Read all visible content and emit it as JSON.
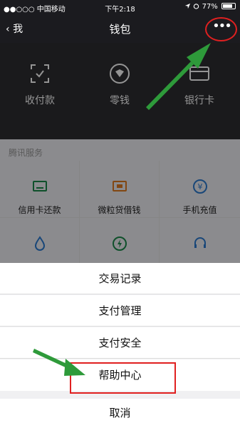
{
  "status_bar": {
    "carrier": "●●○○○ 中国移动",
    "time": "下午2:18",
    "battery": "77%"
  },
  "nav": {
    "back_label": "我",
    "title": "钱包",
    "more_glyph": "•••"
  },
  "wallet_top": [
    {
      "label": "收付款",
      "icon": "scan-pay-icon"
    },
    {
      "label": "零钱",
      "icon": "coin-icon"
    },
    {
      "label": "银行卡",
      "icon": "bank-card-icon"
    }
  ],
  "services": {
    "section_title": "腾讯服务",
    "items": [
      {
        "label": "信用卡还款",
        "icon": "credit-card-icon",
        "color": "#1a8a4a"
      },
      {
        "label": "微粒贷借钱",
        "icon": "loan-icon",
        "color": "#e07a1f"
      },
      {
        "label": "手机充值",
        "icon": "phone-topup-icon",
        "color": "#2b7bd0"
      },
      {
        "label": "",
        "icon": "water-drop-icon",
        "color": "#2b7bd0"
      },
      {
        "label": "",
        "icon": "charge-icon",
        "color": "#1a8a4a"
      },
      {
        "label": "",
        "icon": "headset-icon",
        "color": "#2b7bd0"
      }
    ]
  },
  "action_sheet": {
    "items": [
      "交易记录",
      "支付管理",
      "支付安全",
      "帮助中心"
    ],
    "cancel": "取消"
  },
  "colors": {
    "nav_bg": "#1b1b1f",
    "wallet_bg": "#2d2d31",
    "highlight": "#e02020",
    "arrow": "#2e9a3a"
  }
}
